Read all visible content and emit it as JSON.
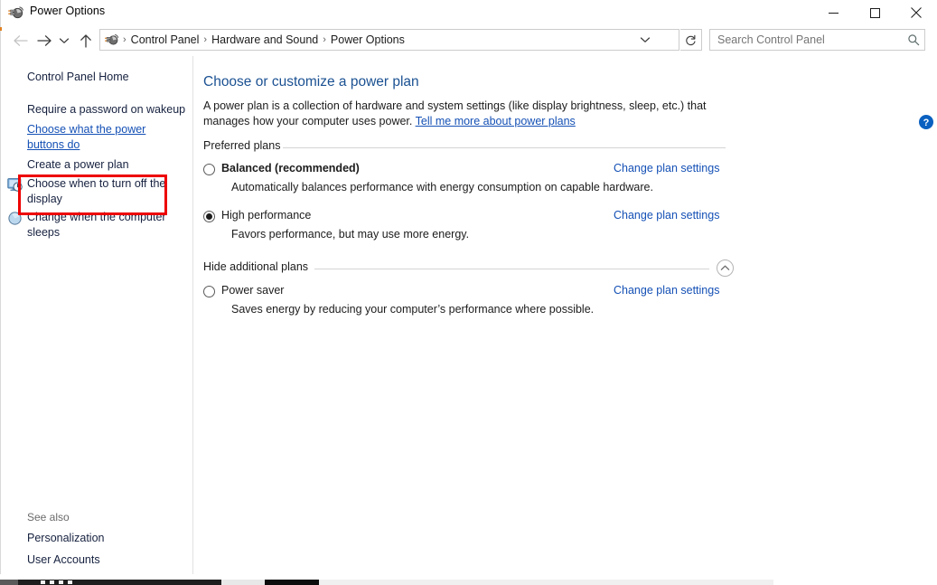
{
  "window": {
    "title": "Power Options",
    "app_icon": "power-plug-icon",
    "controls": {
      "minimize": "minimize-icon",
      "maximize": "maximize-icon",
      "close": "close-icon"
    }
  },
  "nav": {
    "back": "back-arrow-icon",
    "forward": "forward-arrow-icon",
    "recent": "recent-locations-icon",
    "up": "up-arrow-icon",
    "breadcrumb": [
      "Control Panel",
      "Hardware and Sound",
      "Power Options"
    ],
    "separator": "›",
    "dropdown": "chevron-down-icon",
    "refresh": "refresh-icon"
  },
  "search": {
    "placeholder": "Search Control Panel",
    "value": "",
    "icon": "search-icon"
  },
  "sidebar": {
    "items": [
      {
        "label": "Control Panel Home",
        "style": "plain",
        "icon": null
      },
      {
        "label": "Require a password on wakeup",
        "style": "plain",
        "icon": null
      },
      {
        "label": "Choose what the power buttons do",
        "style": "hot",
        "icon": null
      },
      {
        "label": "Create a power plan",
        "style": "plain",
        "icon": null
      },
      {
        "label": "Choose when to turn off the display",
        "style": "plain",
        "icon": "monitor-clock-icon"
      },
      {
        "label": "Change when the computer sleeps",
        "style": "plain",
        "icon": "moon-sphere-icon"
      }
    ],
    "see_also": {
      "heading": "See also",
      "links": [
        "Personalization",
        "User Accounts"
      ]
    }
  },
  "highlight": {
    "color": "#ee0000",
    "target": "Choose what the power buttons do"
  },
  "main": {
    "heading": "Choose or customize a power plan",
    "description_part1": "A power plan is a collection of hardware and system settings (like display brightness, sleep, etc.) that manages how your computer uses power. ",
    "description_link": "Tell me more about power plans",
    "groups": [
      {
        "label": "Preferred plans",
        "collapse_icon": null,
        "plans": [
          {
            "name": "Balanced (recommended)",
            "bold": true,
            "selected": false,
            "description": "Automatically balances performance with energy consumption on capable hardware.",
            "action": "Change plan settings"
          },
          {
            "name": "High performance",
            "bold": false,
            "selected": true,
            "description": "Favors performance, but may use more energy.",
            "action": "Change plan settings"
          }
        ]
      },
      {
        "label": "Hide additional plans",
        "collapse_icon": "chevron-up-icon",
        "plans": [
          {
            "name": "Power saver",
            "bold": false,
            "selected": false,
            "description": "Saves energy by reducing your computer’s performance where possible.",
            "action": "Change plan settings"
          }
        ]
      }
    ]
  },
  "help": {
    "label": "?",
    "icon": "help-circle-icon",
    "color": "#0a60c0"
  }
}
